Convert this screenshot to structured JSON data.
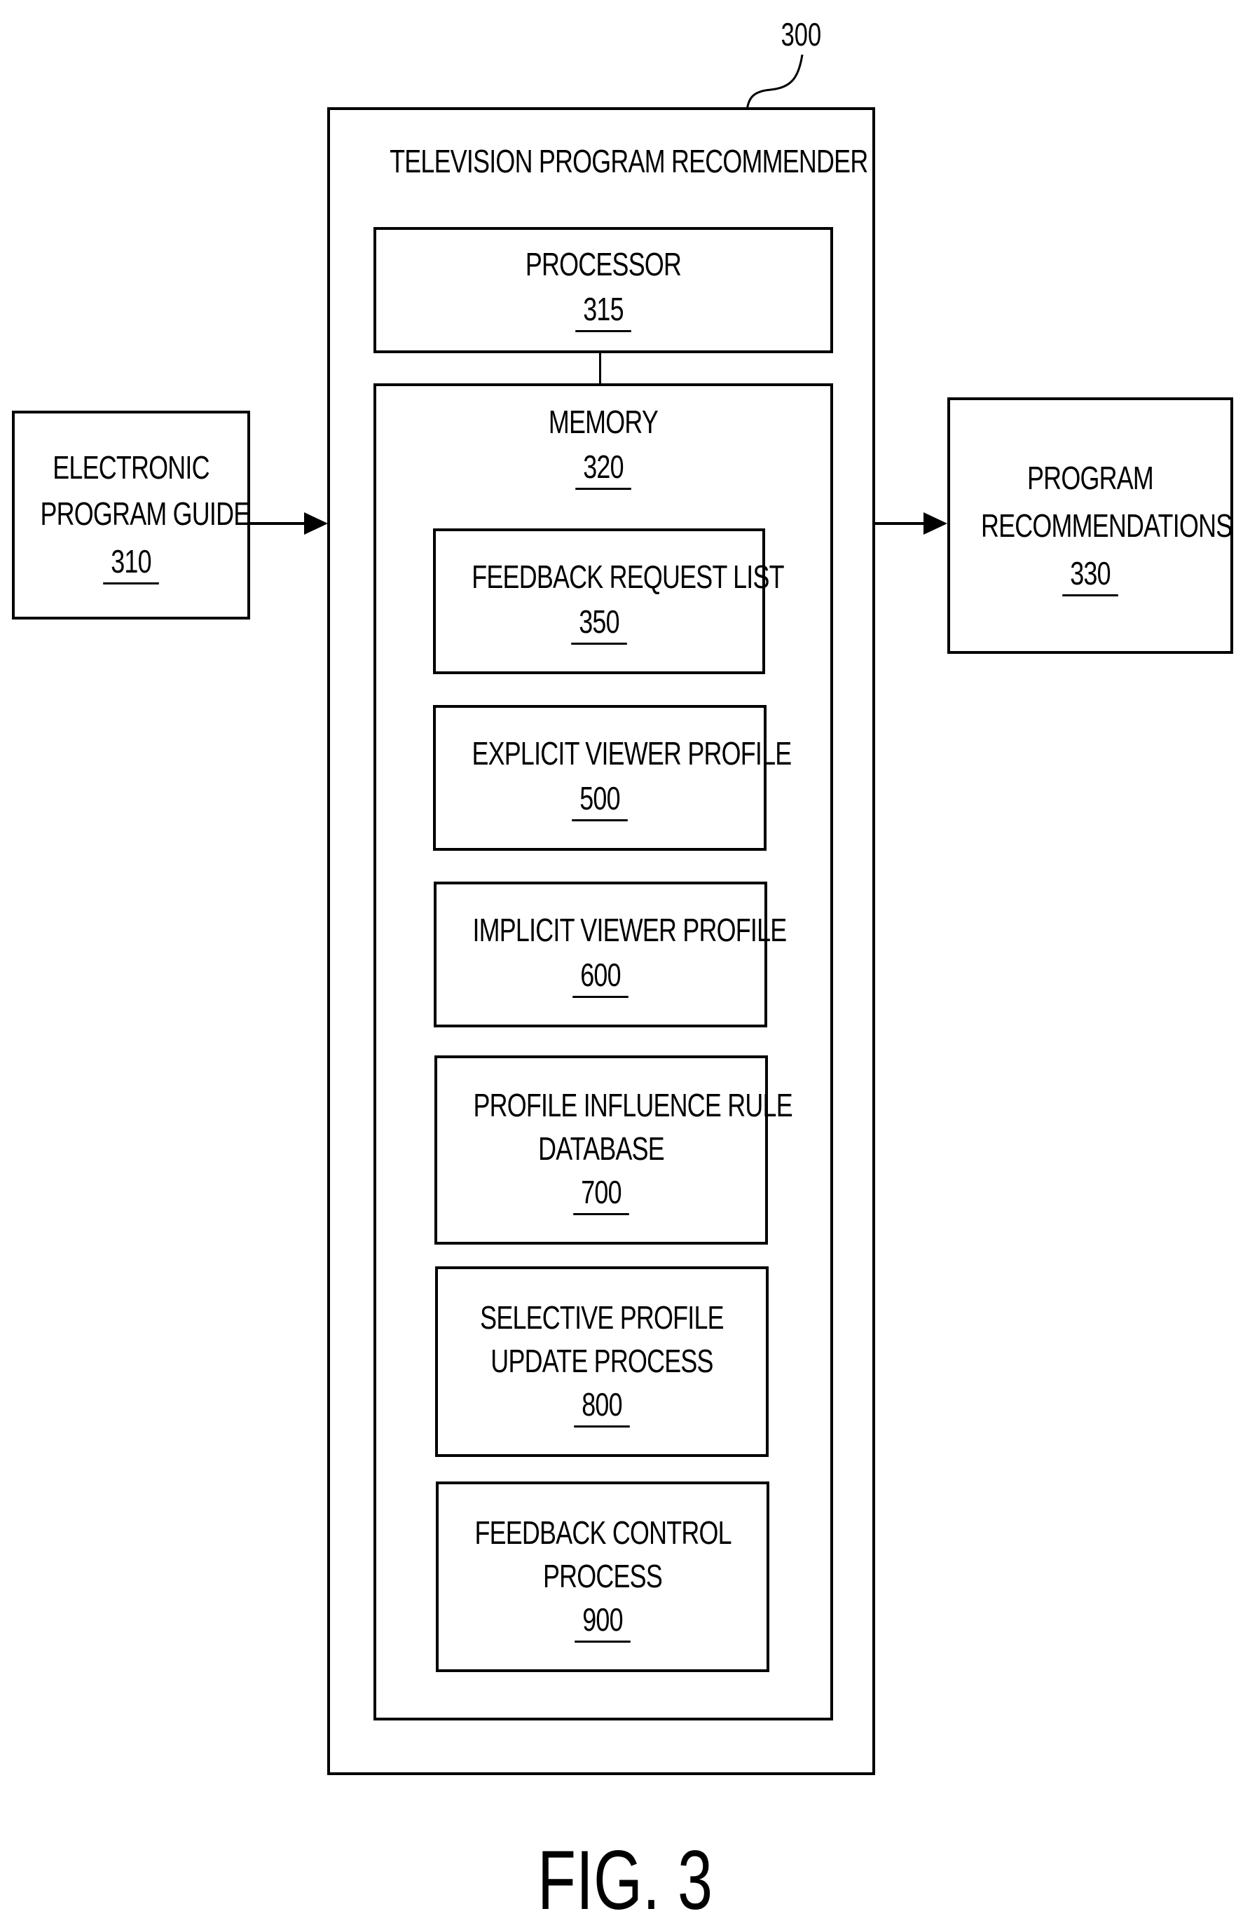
{
  "figure": {
    "caption": "FIG. 3",
    "system_ref": "300"
  },
  "recommender": {
    "title": "TELEVISION PROGRAM RECOMMENDER",
    "processor": {
      "label": "PROCESSOR",
      "ref": "315"
    },
    "memory": {
      "label": "MEMORY",
      "ref": "320",
      "components": [
        {
          "lines": [
            "FEEDBACK REQUEST LIST"
          ],
          "ref": "350"
        },
        {
          "lines": [
            "EXPLICIT VIEWER PROFILE"
          ],
          "ref": "500"
        },
        {
          "lines": [
            "IMPLICIT VIEWER PROFILE"
          ],
          "ref": "600"
        },
        {
          "lines": [
            "PROFILE INFLUENCE RULE",
            "DATABASE"
          ],
          "ref": "700"
        },
        {
          "lines": [
            "SELECTIVE PROFILE",
            "UPDATE PROCESS"
          ],
          "ref": "800"
        },
        {
          "lines": [
            "FEEDBACK CONTROL",
            "PROCESS"
          ],
          "ref": "900"
        }
      ]
    }
  },
  "inputs": {
    "epg": {
      "lines": [
        "ELECTRONIC",
        "PROGRAM GUIDE"
      ],
      "ref": "310"
    }
  },
  "outputs": {
    "recommendations": {
      "lines": [
        "PROGRAM",
        "RECOMMENDATIONS"
      ],
      "ref": "330"
    }
  },
  "colors": {
    "stroke": "#000000",
    "background": "#ffffff"
  }
}
